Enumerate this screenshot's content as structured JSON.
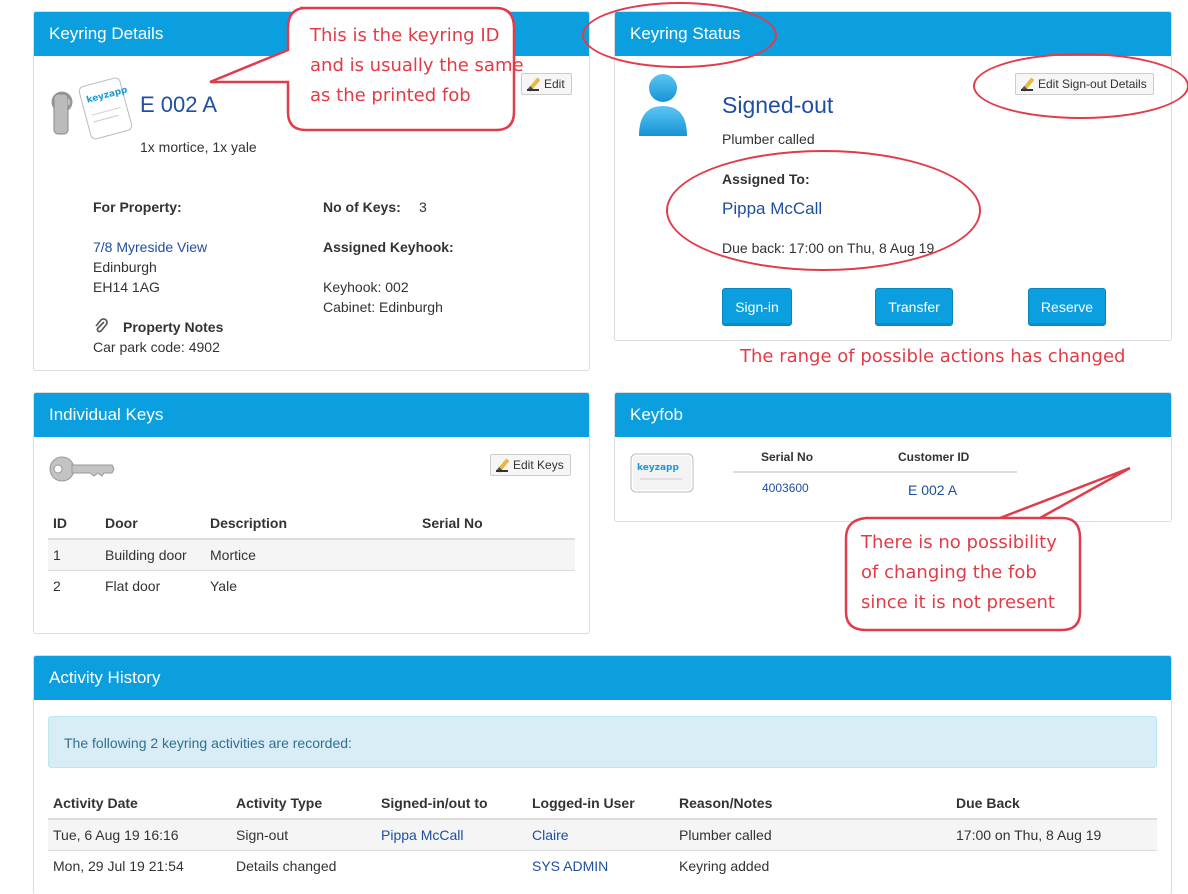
{
  "keyring_details": {
    "title": "Keyring Details",
    "edit_label": "Edit",
    "keyring_id": "E 002 A",
    "description": "1x mortice, 1x yale",
    "for_property_label": "For Property:",
    "address_line1": "7/8 Myreside View",
    "address_line2": "Edinburgh",
    "address_line3": "EH14 1AG",
    "no_of_keys_label": "No of Keys:",
    "no_of_keys_value": "3",
    "assigned_keyhook_label": "Assigned Keyhook:",
    "keyhook": "Keyhook: 002",
    "cabinet": "Cabinet: Edinburgh",
    "property_notes_label": "Property Notes",
    "property_notes": "Car park code: 4902",
    "fob_text": "keyzapp"
  },
  "keyring_status": {
    "title": "Keyring Status",
    "edit_label": "Edit Sign-out Details",
    "status": "Signed-out",
    "reason": "Plumber called",
    "assigned_to_label": "Assigned To:",
    "assigned_to": "Pippa McCall",
    "due_back": "Due back: 17:00 on Thu, 8 Aug 19",
    "actions": {
      "sign_in": "Sign-in",
      "transfer": "Transfer",
      "reserve": "Reserve"
    }
  },
  "individual_keys": {
    "title": "Individual Keys",
    "edit_label": "Edit Keys",
    "columns": [
      "ID",
      "Door",
      "Description",
      "Serial No"
    ],
    "rows": [
      {
        "id": "1",
        "door": "Building door",
        "description": "Mortice",
        "serial": ""
      },
      {
        "id": "2",
        "door": "Flat door",
        "description": "Yale",
        "serial": ""
      }
    ]
  },
  "keyfob": {
    "title": "Keyfob",
    "serial_label": "Serial No",
    "customer_label": "Customer ID",
    "serial": "4003600",
    "customer_id": "E 002 A",
    "fob_text": "keyzapp"
  },
  "activity_history": {
    "title": "Activity History",
    "info": "The following 2 keyring activities are recorded:",
    "columns": [
      "Activity Date",
      "Activity Type",
      "Signed-in/out to",
      "Logged-in User",
      "Reason/Notes",
      "Due Back"
    ],
    "rows": [
      {
        "date": "Tue, 6 Aug 19 16:16",
        "type": "Sign-out",
        "to": "Pippa McCall",
        "user": "Claire",
        "notes": "Plumber called",
        "due": "17:00 on Thu, 8 Aug 19"
      },
      {
        "date": "Mon, 29 Jul 19 21:54",
        "type": "Details changed",
        "to": "",
        "user": "SYS ADMIN",
        "notes": "Keyring added",
        "due": ""
      }
    ]
  },
  "annotations": {
    "keyring_id_callout_line1": "This is the keyring ID",
    "keyring_id_callout_line2": "and is usually the same",
    "keyring_id_callout_line3": "as the printed fob",
    "actions_note": "The range of possible actions has changed",
    "fob_callout_line1": "There is no possibility",
    "fob_callout_line2": "of changing the fob",
    "fob_callout_line3": "since it is not present"
  },
  "colors": {
    "header_blue": "#0b9fe0",
    "link_blue": "#1f4fa0",
    "annotation_red": "#e23b47"
  }
}
